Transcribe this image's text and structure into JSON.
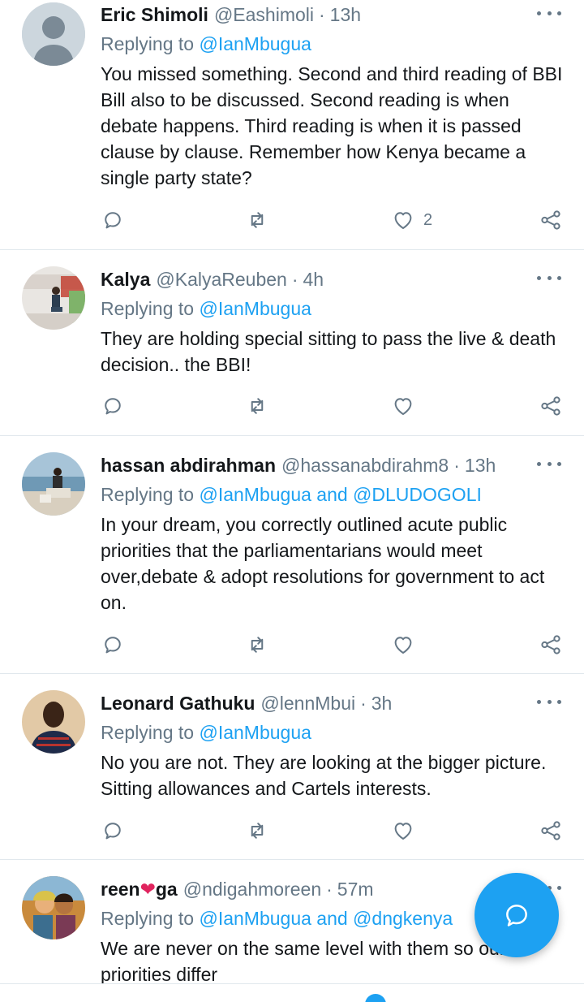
{
  "colors": {
    "accent": "#1da1f2",
    "secondary_text": "#657786",
    "divider": "#e1e8ed",
    "heart": "#e0245e"
  },
  "tweets": [
    {
      "name": "Eric Shimoli",
      "handle": "@Eashimoli",
      "time": "13h",
      "reply_prefix": "Replying to",
      "reply_targets": "@IanMbugua",
      "text": "You missed something. Second and third reading of BBI Bill also to be discussed. Second reading is when debate happens. Third reading is when it is passed clause by clause. Remember how Kenya became a single party state?",
      "likes": "2"
    },
    {
      "name": "Kalya",
      "handle": "@KalyaReuben",
      "time": "4h",
      "reply_prefix": "Replying to",
      "reply_targets": "@IanMbugua",
      "text": "They are holding special sitting to pass the live & death decision.. the BBI!",
      "likes": ""
    },
    {
      "name": "hassan abdirahman",
      "handle": "@hassanabdirahm8",
      "time": "13h",
      "reply_prefix": "Replying to",
      "reply_targets": "@IanMbugua and @DLUDOGOLI",
      "text": "In your dream, you correctly outlined acute public priorities that the parliamentarians would meet over,debate & adopt resolutions for government to act on.",
      "likes": ""
    },
    {
      "name": "Leonard Gathuku",
      "handle": "@lennMbui",
      "time": "3h",
      "reply_prefix": "Replying to",
      "reply_targets": "@IanMbugua",
      "text": "No you are not. They are looking at the bigger picture. Sitting allowances and Cartels interests.",
      "likes": ""
    },
    {
      "name_start": "reen",
      "name_end": "ga",
      "handle": "@ndigahmoreen",
      "time": "57m",
      "reply_prefix": "Replying to",
      "reply_targets": "@IanMbugua and @dngkenya",
      "text": "We are never on the same level with them so our priorities differ",
      "likes": ""
    }
  ],
  "icons": {
    "reply": "reply-icon",
    "retweet": "retweet-icon",
    "like": "heart-icon",
    "share": "share-icon",
    "more": "more-dots-icon",
    "compose": "compose-reply-icon"
  }
}
